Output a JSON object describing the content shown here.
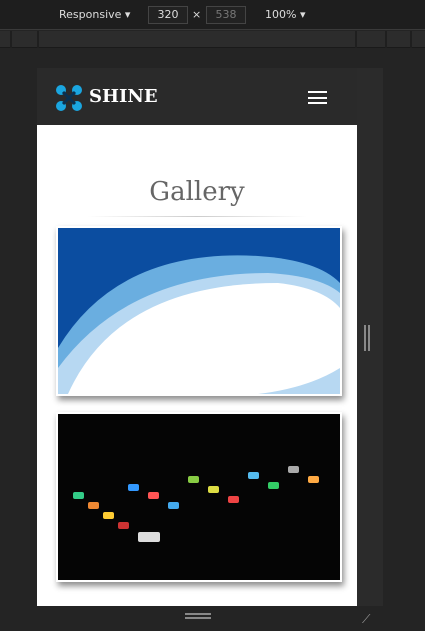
{
  "devtools": {
    "device": "Responsive",
    "width": "320",
    "times": "×",
    "height": "538",
    "zoom": "100%"
  },
  "site": {
    "brand": "SHINE",
    "title": "Gallery"
  }
}
